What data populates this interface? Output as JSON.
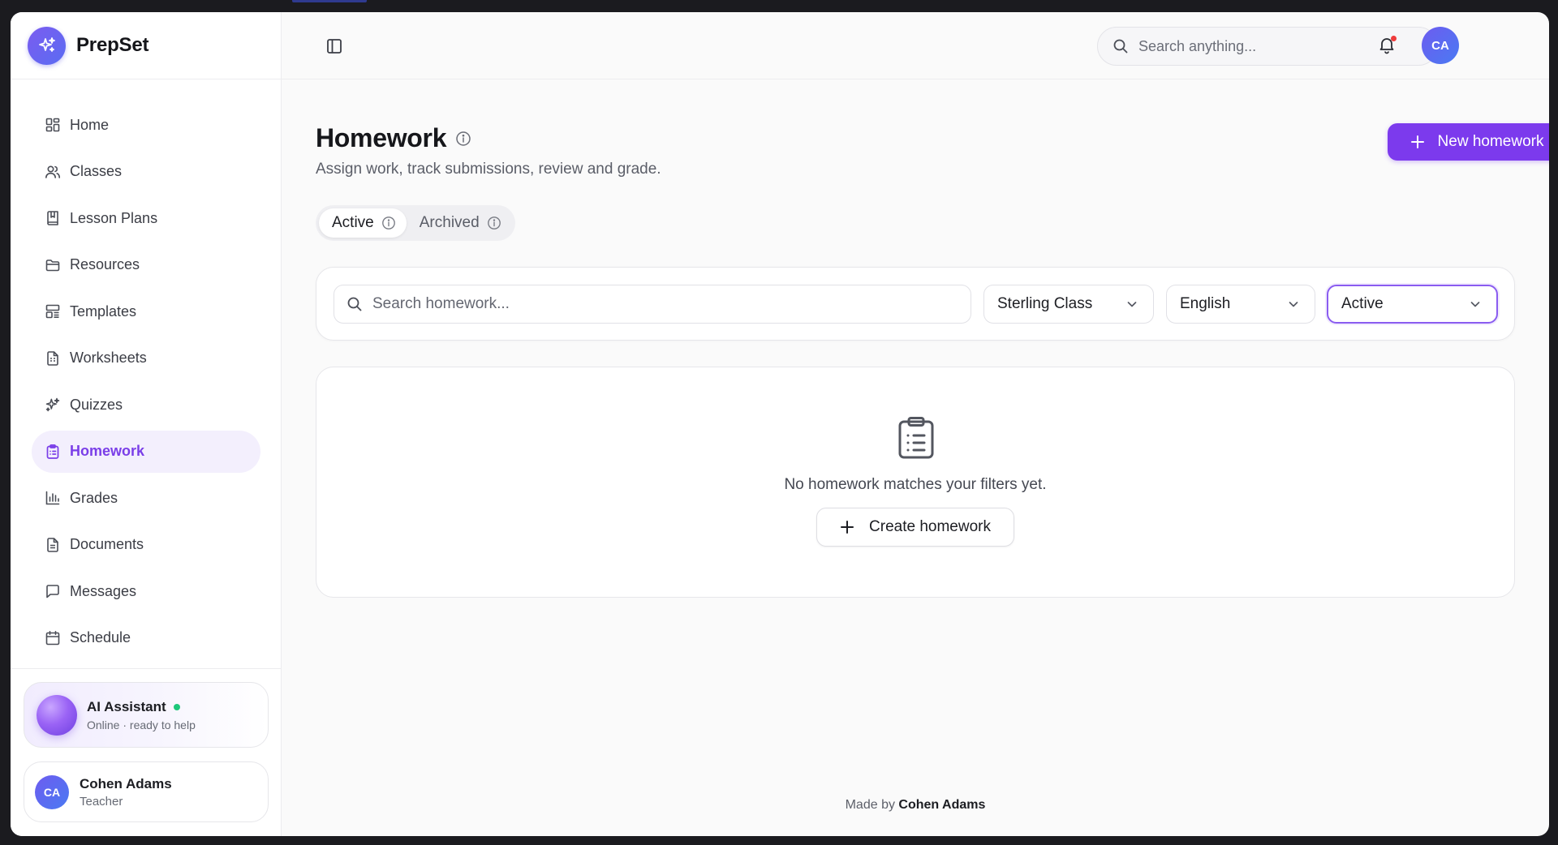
{
  "app": {
    "brand": "PrepSet",
    "accent": "#7c3aed",
    "brand_gradient": [
      "#7b5cf0",
      "#5a6cf2"
    ]
  },
  "sidebar": {
    "items": [
      {
        "label": "Home",
        "icon": "home-icon"
      },
      {
        "label": "Classes",
        "icon": "users-icon"
      },
      {
        "label": "Lesson Plans",
        "icon": "book-icon"
      },
      {
        "label": "Resources",
        "icon": "folder-icon"
      },
      {
        "label": "Templates",
        "icon": "template-icon"
      },
      {
        "label": "Worksheets",
        "icon": "worksheet-icon"
      },
      {
        "label": "Quizzes",
        "icon": "sparkle-icon"
      },
      {
        "label": "Homework",
        "icon": "clipboard-icon",
        "active": true
      },
      {
        "label": "Grades",
        "icon": "bar-chart-icon"
      },
      {
        "label": "Documents",
        "icon": "document-icon"
      },
      {
        "label": "Messages",
        "icon": "message-icon"
      },
      {
        "label": "Schedule",
        "icon": "calendar-icon"
      }
    ],
    "assistant": {
      "title": "AI Assistant",
      "status": "Online · ready to help",
      "status_color": "#1dc77a"
    },
    "user": {
      "initials": "CA",
      "name": "Cohen Adams",
      "role": "Teacher"
    }
  },
  "topbar": {
    "search_placeholder": "Search anything...",
    "avatar_initials": "CA",
    "has_notification": true
  },
  "page": {
    "title": "Homework",
    "subtitle": "Assign work, track submissions, review and grade.",
    "new_button": "New homework",
    "tabs": [
      {
        "label": "Active",
        "selected": true
      },
      {
        "label": "Archived",
        "selected": false
      }
    ]
  },
  "filters": {
    "search_placeholder": "Search homework...",
    "class": "Sterling Class",
    "subject": "English",
    "status": "Active"
  },
  "empty": {
    "message": "No homework matches your filters yet.",
    "button": "Create homework"
  },
  "footer": {
    "prefix": "Made by",
    "author": "Cohen Adams"
  }
}
